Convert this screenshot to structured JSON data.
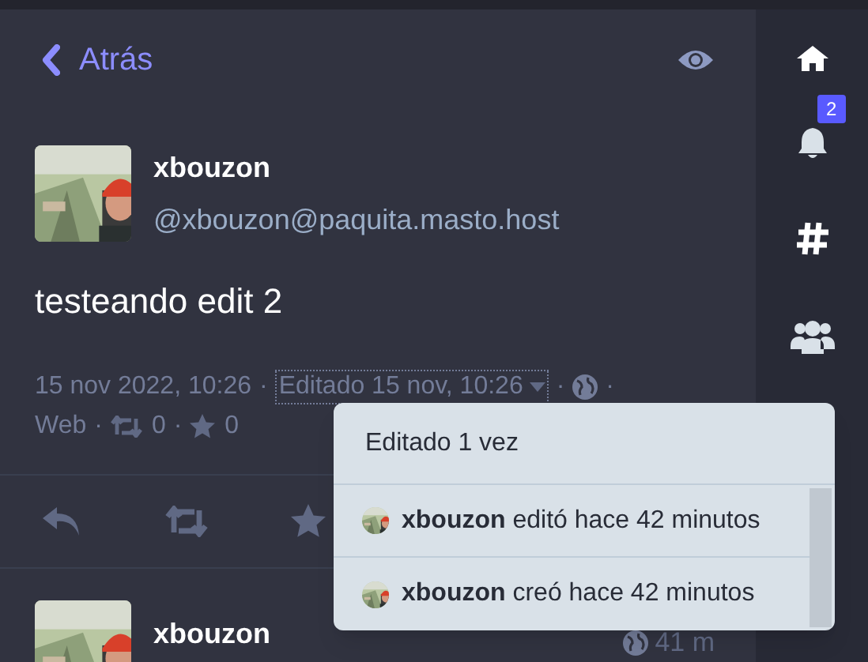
{
  "back_link": {
    "label": "Atrás"
  },
  "status": {
    "author": {
      "display_name": "xbouzon",
      "handle": "@xbouzon@paquita.masto.host"
    },
    "content": "testeando edit 2",
    "meta": [
      {
        "kind": "text",
        "text": "15 nov 2022, 10:26"
      },
      {
        "kind": "separator",
        "text": "·"
      },
      {
        "kind": "edited",
        "text": "Editado 15 nov, 10:26"
      },
      {
        "kind": "separator",
        "text": "·"
      },
      {
        "kind": "globe"
      },
      {
        "kind": "separator",
        "text": "·"
      },
      {
        "kind": "text",
        "text": "Web"
      },
      {
        "kind": "separator",
        "text": "·"
      },
      {
        "kind": "reblogs",
        "text": "0"
      },
      {
        "kind": "separator",
        "text": "·"
      },
      {
        "kind": "favourites",
        "text": "0"
      }
    ],
    "actions": [
      {
        "kind": "reply"
      },
      {
        "kind": "boost"
      },
      {
        "kind": "favourite"
      }
    ]
  },
  "edit_history": {
    "title": "Editado 1 vez",
    "entries": [
      {
        "text": "**xbouzon** editó hace 42 minutos"
      },
      {
        "text": "**xbouzon** creó hace 42 minutos"
      }
    ]
  },
  "next_status": {
    "display_name": "xbouzon",
    "time": "41 m"
  },
  "sidebar": {
    "items": [
      {
        "kind": "home"
      },
      {
        "kind": "notifications",
        "badge": "2"
      },
      {
        "kind": "hashtag"
      },
      {
        "kind": "people"
      }
    ]
  }
}
